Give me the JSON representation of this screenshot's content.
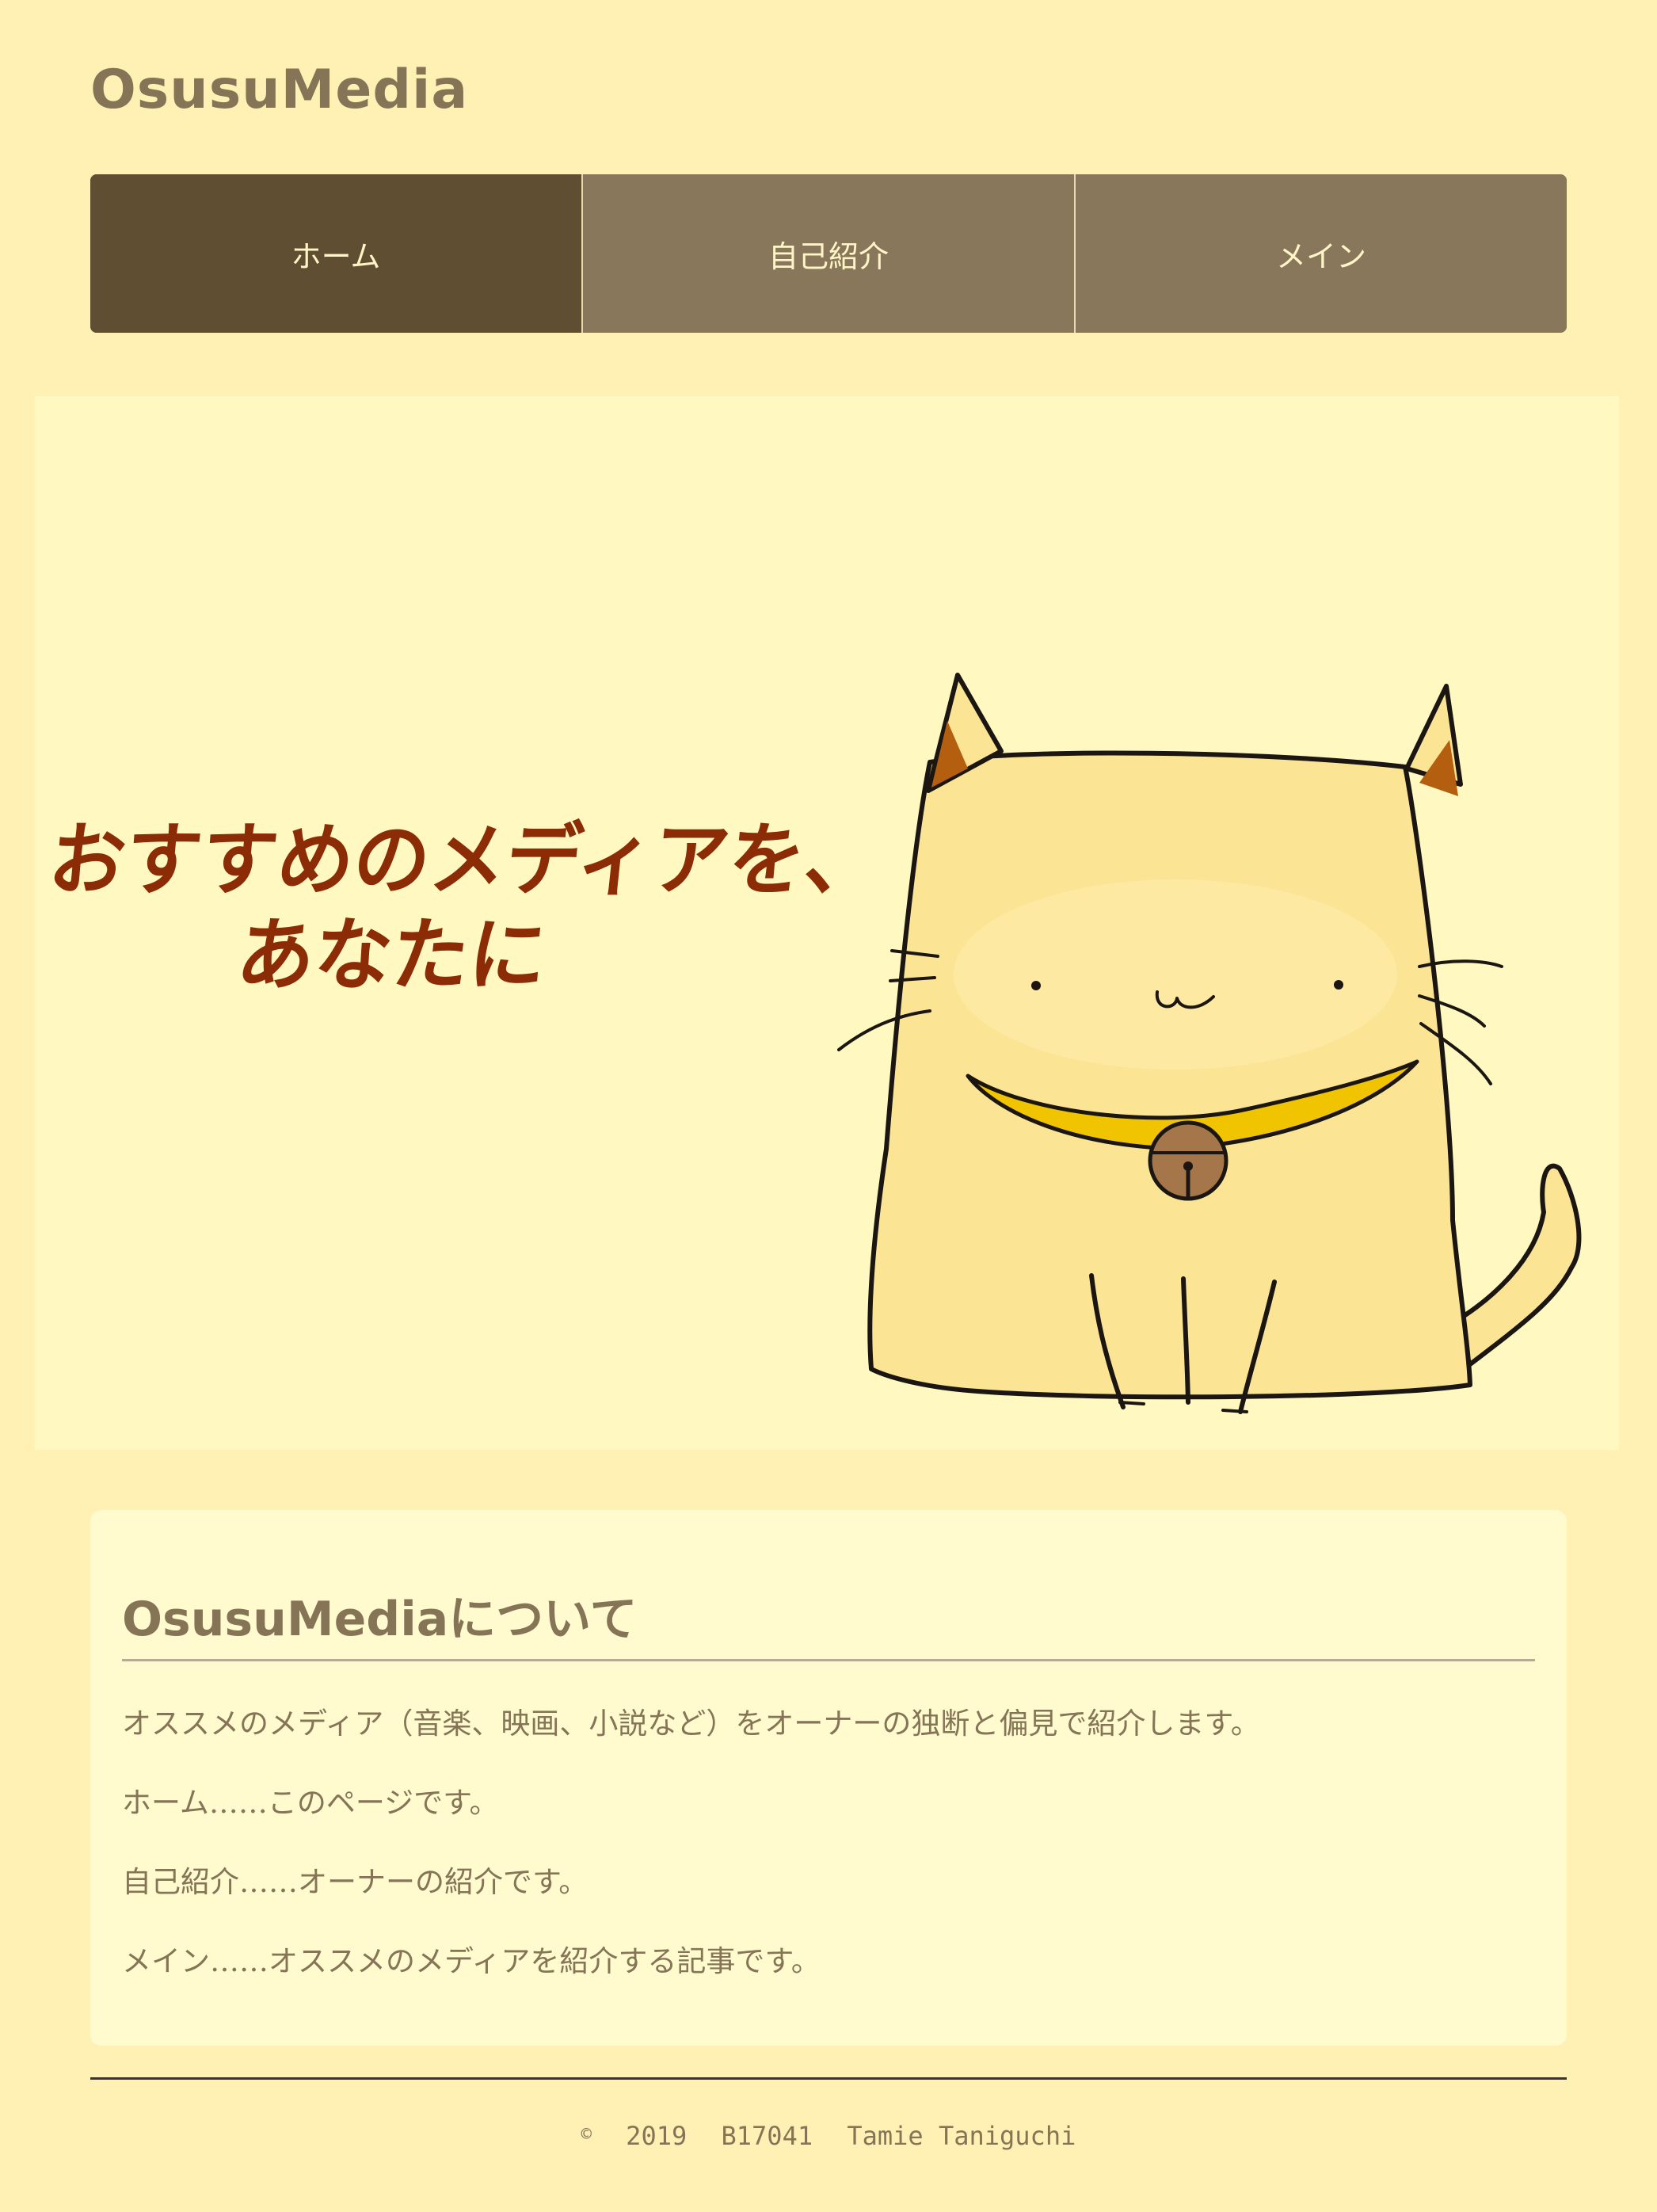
{
  "site": {
    "title": "OsusuMedia"
  },
  "nav": {
    "items": [
      {
        "label": "ホーム",
        "active": true
      },
      {
        "label": "自己紹介",
        "active": false
      },
      {
        "label": "メイン",
        "active": false
      }
    ]
  },
  "hero": {
    "headline_line1": "おすすめのメディアを、",
    "headline_line2": "あなたに"
  },
  "about": {
    "title": "OsusuMediaについて",
    "paragraphs": [
      "オススメのメディア（音楽、映画、小説など）をオーナーの独断と偏見で紹介します。",
      "ホーム……このページです。",
      "自己紹介……オーナーの紹介です。",
      "メイン……オススメのメディアを紹介する記事です。"
    ]
  },
  "footer": {
    "copyright_symbol": "©",
    "year": "2019",
    "student_id": "B17041",
    "author": "Tamie Taniguchi"
  },
  "colors": {
    "page_bg": "#fff1b4",
    "nav_bg": "#88775a",
    "nav_active": "#604e32",
    "text": "#857456",
    "headline": "#8b2c06",
    "cat_body": "#fbe595",
    "cat_collar": "#f0c400",
    "bell": "#a5764a"
  }
}
